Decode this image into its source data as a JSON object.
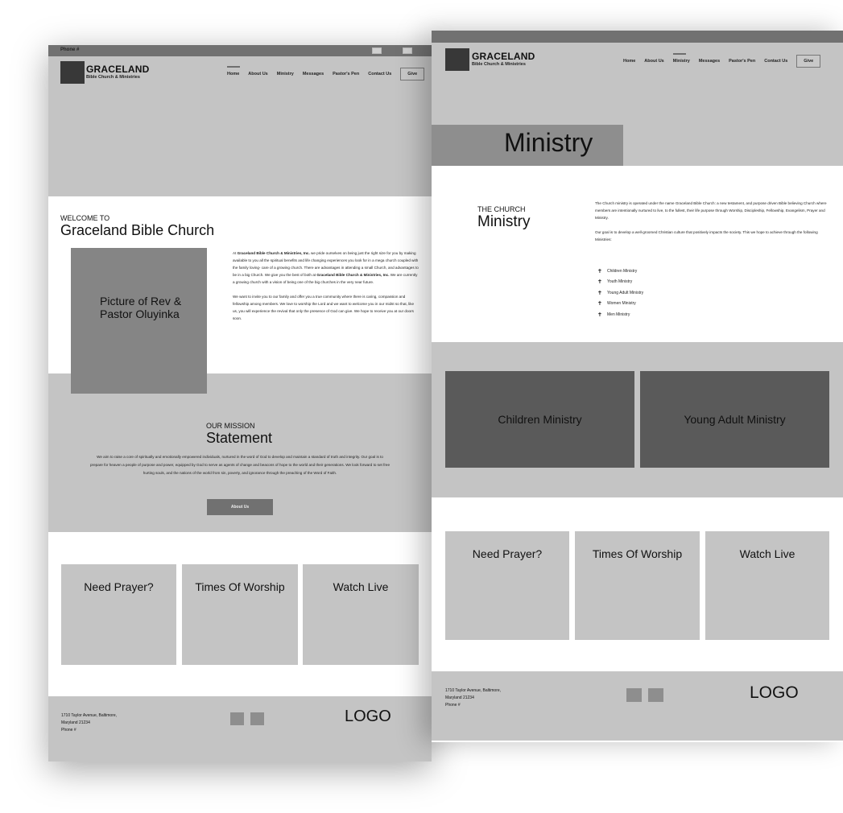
{
  "home_page": {
    "topbar": {
      "phone": "Phone #"
    },
    "header": {
      "brand_name": "GRACELAND",
      "brand_sub": "Bible Church & Ministries",
      "nav": [
        "Home",
        "About Us",
        "Ministry",
        "Messages",
        "Pastor's Pen",
        "Contact Us"
      ],
      "active_nav": "Home",
      "give_label": "Give"
    },
    "welcome": {
      "eyebrow": "WELCOME TO",
      "title": "Graceland Bible Church",
      "picture_label": "Picture of Rev & Pastor Oluyinka",
      "para1_pre": "At ",
      "para1_bold1": "Graceland Bible Church & Ministries, Inc.",
      "para1_mid": " we pride ourselves on being just the right size for you by making available to you all the spiritual benefits and life changing experiences you look for in a mega church coupled with the family loving- care of a growing church. There are advantages in attending a small Church, and advantages to be in a big Church. We give you the best of both at ",
      "para1_bold2": "Graceland Bible Church & Ministries, Inc.",
      "para1_post": " We are currently a growing church with a vision of being one of the big churches in the very near future.",
      "para2": "We want to invite you to our family and offer you a true community where there is caring, compassion and fellowship among members. We love to worship the Lord and we want to welcome you in our midst so that, like us, you will experience the revival that only the presence of God can give. We hope to receive you at our doors soon."
    },
    "mission": {
      "eyebrow": "OUR MISSION",
      "title": "Statement",
      "body": "We aim to raise a core of spiritually and emotionally empowered individuals, nurtured in the word of God to develop and maintain a standard of truth and integrity. Our goal is to prepare for heaven a people of purpose and power, equipped by God to serve as agents of change and beacons of hope to the world and their generations. We look forward to set free hurting souls, and the nations of the world from sin, poverty, and ignorance through the preaching of the Word of Faith.",
      "button_label": "About Us"
    },
    "cards": [
      "Need Prayer?",
      "Times Of Worship",
      "Watch Live"
    ],
    "footer": {
      "address_line1": "1710 Taylor Avenue, Baltimore,",
      "address_line2": "Maryland 21234",
      "phone": "Phone #",
      "logo": "LOGO"
    }
  },
  "ministry_page": {
    "header": {
      "brand_name": "GRACELAND",
      "brand_sub": "Bible Church & Ministries",
      "nav": [
        "Home",
        "About Us",
        "Ministry",
        "Messages",
        "Pastor's Pen",
        "Contact Us"
      ],
      "active_nav": "Ministry",
      "give_label": "Give"
    },
    "hero_title": "Ministry",
    "intro": {
      "eyebrow": "THE CHURCH",
      "title": "Ministry",
      "para1": "The Church ministry is operated under the name Graceland Bible Church: a new testament, and purpose driven Bible believing Church where members are intentionally nurtured to live, to the fullest, their life purpose through Worship, Discipleship, Fellowship, Evangelism, Prayer and Ministry.",
      "para2": "Our goal is to develop a well-groomed Christian culture that positively impacts the society. This we hope to achieve through the following Ministries:",
      "list_icon": "cross-icon",
      "ministries": [
        "Children Ministry",
        "Youth Ministry",
        "Young Adult Ministry",
        "Women Ministry",
        "Men Ministry"
      ]
    },
    "tiles": [
      "Children Ministry",
      "Young Adult Ministry"
    ],
    "cards": [
      "Need Prayer?",
      "Times Of Worship",
      "Watch Live"
    ],
    "footer": {
      "address_line1": "1710 Taylor Avenue, Baltimore,",
      "address_line2": "Maryland 21234",
      "phone": "Phone #",
      "logo": "LOGO"
    }
  }
}
